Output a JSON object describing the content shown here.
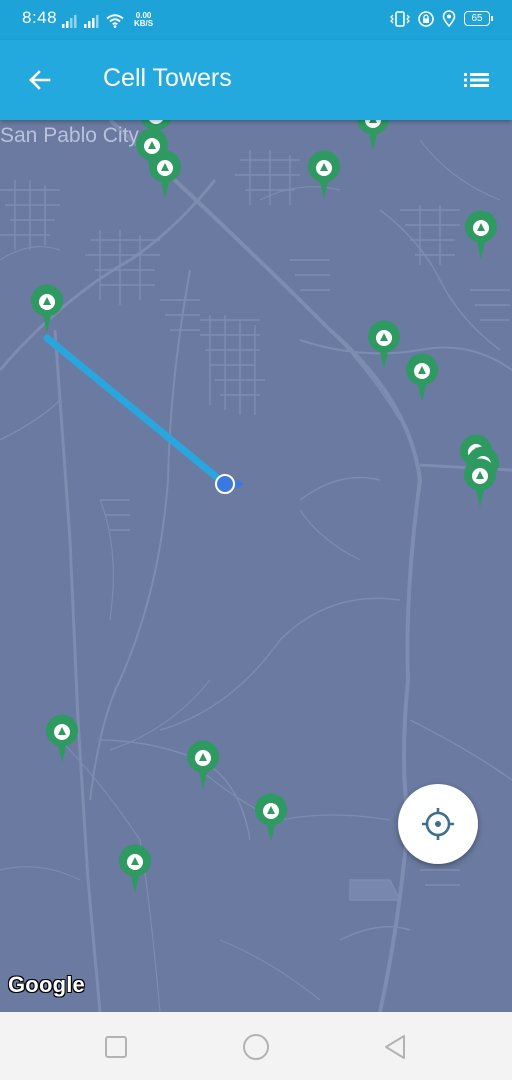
{
  "status_bar": {
    "time": "8:48",
    "net_speed_value": "0.00",
    "net_speed_unit": "KB/S",
    "battery_level": "65",
    "icons": [
      "signal-icon",
      "signal-icon",
      "wifi-icon",
      "vibrate-icon",
      "lock-icon",
      "location-icon",
      "battery-icon"
    ]
  },
  "app_bar": {
    "title": "Cell Towers",
    "back_icon": "arrow-left-icon",
    "menu_icon": "list-icon",
    "color": "#23a9de"
  },
  "map": {
    "city_label": "San Pablo City",
    "background_color": "#6a7aa0",
    "marker_color": "#2e9a62",
    "connection_line_color": "#2aa6df",
    "current_location_color": "#3b78e0",
    "attribution": "Google"
  },
  "locate_button": {
    "icon": "crosshair-icon"
  },
  "nav_bar": {
    "icons": [
      "square-icon",
      "circle-icon",
      "triangle-back-icon"
    ]
  }
}
